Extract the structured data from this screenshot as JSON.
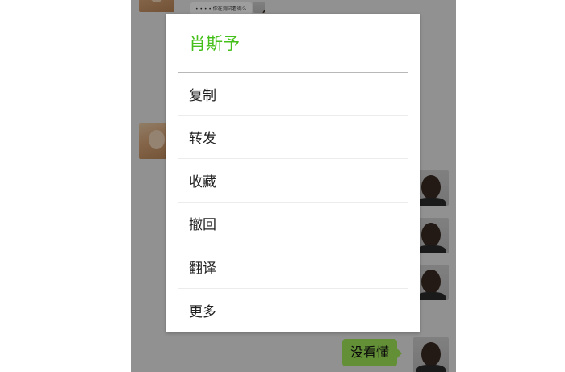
{
  "chat": {
    "top_preview_text": "• • • • 你在测试看得么",
    "last_message": "没看懂"
  },
  "popup": {
    "title": "肖斯予",
    "items": [
      {
        "label": "复制"
      },
      {
        "label": "转发"
      },
      {
        "label": "收藏"
      },
      {
        "label": "撤回"
      },
      {
        "label": "翻译"
      },
      {
        "label": "更多"
      }
    ]
  },
  "colors": {
    "accent_green": "#45c01a",
    "bubble_green": "#a0e75a",
    "chat_background": "#ebebeb"
  }
}
